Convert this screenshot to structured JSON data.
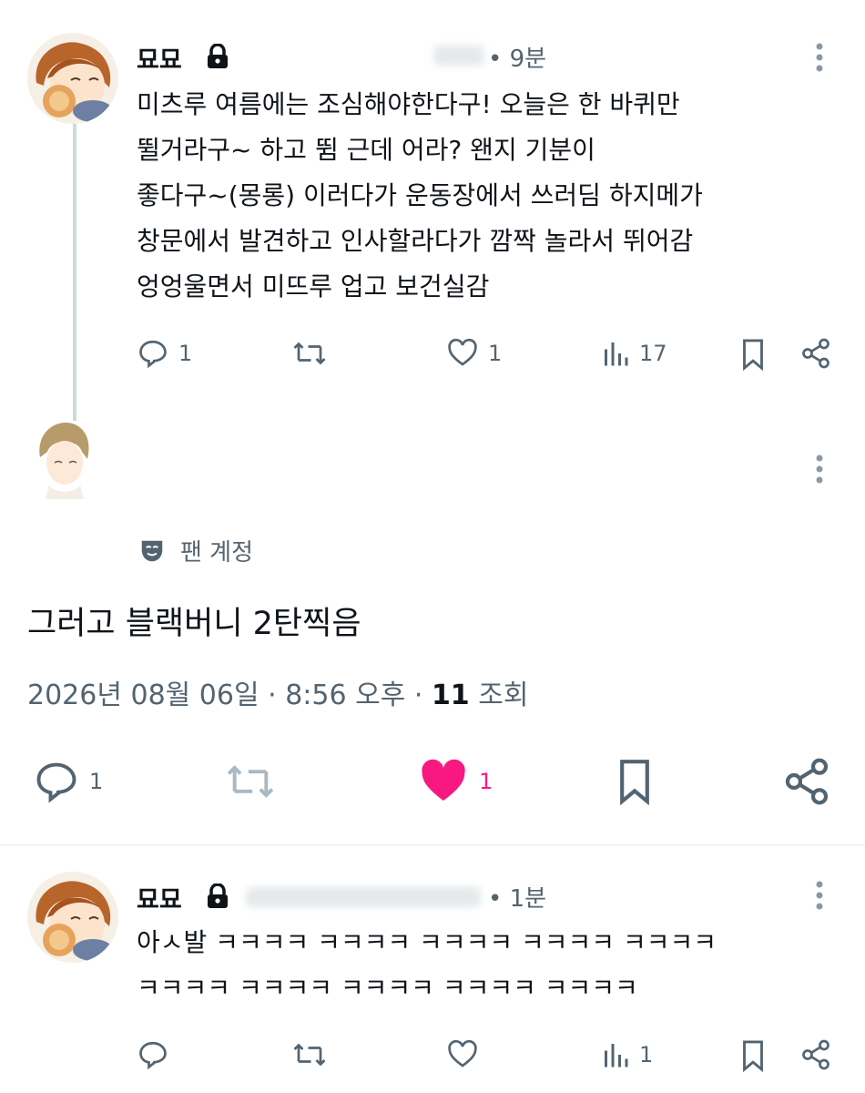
{
  "thread": [
    {
      "author": "묘묘",
      "time": "9분",
      "text": [
        "미츠루 여름에는 조심해야한다구! 오늘은 한 바퀴만",
        "뛸거라구~ 하고 뜀 근데 어라? 왠지 기분이",
        "좋다구~(몽롱) 이러다가 운동장에서 쓰러딤 하지메가",
        "창문에서 발견하고 인사할라다가 깜짝 놀라서 뛰어감",
        "엉엉울면서 미뜨루 업고 보건실감"
      ],
      "replies": "1",
      "likes": "1",
      "views": "17"
    }
  ],
  "main_tweet": {
    "fan_account_label": "팬 계정",
    "text": "그러고 블랙버니 2탄찍음",
    "date": "2026년 08월 06일",
    "time": "8:56 오후",
    "views_count": "11",
    "views_label": "조회",
    "replies": "1",
    "likes": "1",
    "like_color": "#f91880"
  },
  "reply": {
    "author": "묘묘",
    "time": "1분",
    "text": [
      "아ㅅ발 ㅋㅋㅋㅋ ㅋㅋㅋㅋ ㅋㅋㅋㅋ ㅋㅋㅋㅋ ㅋㅋㅋㅋ",
      "ㅋㅋㅋㅋ ㅋㅋㅋㅋ ㅋㅋㅋㅋ ㅋㅋㅋㅋ ㅋㅋㅋㅋ"
    ],
    "views": "1"
  }
}
